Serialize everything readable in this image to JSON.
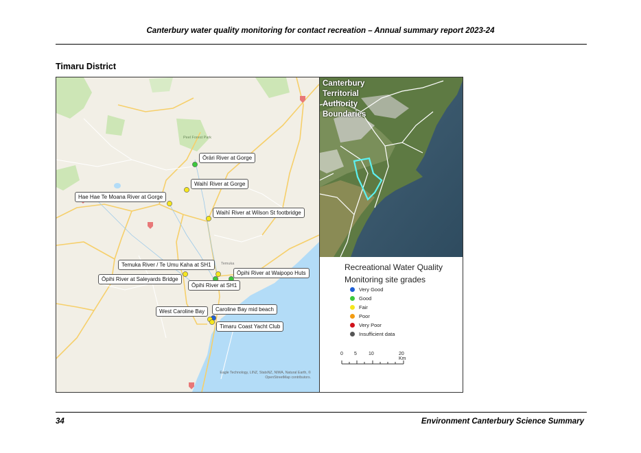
{
  "header": {
    "title": "Canterbury water quality monitoring for contact recreation – Annual summary report 2023-24"
  },
  "section": {
    "title": "Timaru District"
  },
  "footer": {
    "page_number": "34",
    "publication": "Environment Canterbury Science Summary"
  },
  "map": {
    "forest_label": "Peel Forest Park",
    "town_label": "Temuka",
    "attribution_line1": "Eagle Technology, LINZ, StatsNZ, NIWA, Natural Earth, ©",
    "attribution_line2": "OpenStreetMap contributors.",
    "sites": [
      {
        "name": "Ōrāri River at Gorge",
        "grade": "Good"
      },
      {
        "name": "Waihī River at Gorge",
        "grade": "Fair"
      },
      {
        "name": "Hae Hae Te Moana River at Gorge",
        "grade": "Fair"
      },
      {
        "name": "Waihī River at Wilson St footbridge",
        "grade": "Fair"
      },
      {
        "name": "Temuka River / Te Umu Kaha at SH1",
        "grade": "Fair"
      },
      {
        "name": "Ōpihi River at Waipopo Huts",
        "grade": "Good"
      },
      {
        "name": "Ōpihi River at Saleyards Bridge",
        "grade": "Fair"
      },
      {
        "name": "Ōpihi River at SH1",
        "grade": "Good"
      },
      {
        "name": "West Caroline Bay",
        "grade": "Fair"
      },
      {
        "name": "Caroline Bay mid beach",
        "grade": "Very Good"
      },
      {
        "name": "Timaru Coast Yacht Club",
        "grade": "Fair"
      }
    ]
  },
  "inset": {
    "title_lines": [
      "Canterbury",
      "Territorial",
      "Authority",
      "Boundaries"
    ]
  },
  "legend": {
    "title_line1": "Recreational Water Quality",
    "title_line2": "Monitoring site grades",
    "items": [
      {
        "label": "Very Good",
        "color": "#1f5fd6"
      },
      {
        "label": "Good",
        "color": "#3cc83c"
      },
      {
        "label": "Fair",
        "color": "#f5e61e"
      },
      {
        "label": "Poor",
        "color": "#f39c12"
      },
      {
        "label": "Very Poor",
        "color": "#d0121b"
      },
      {
        "label": "Insufficient data",
        "color": "#555555"
      }
    ],
    "scale_ticks": [
      "0",
      "5",
      "10",
      "20 Km"
    ]
  }
}
